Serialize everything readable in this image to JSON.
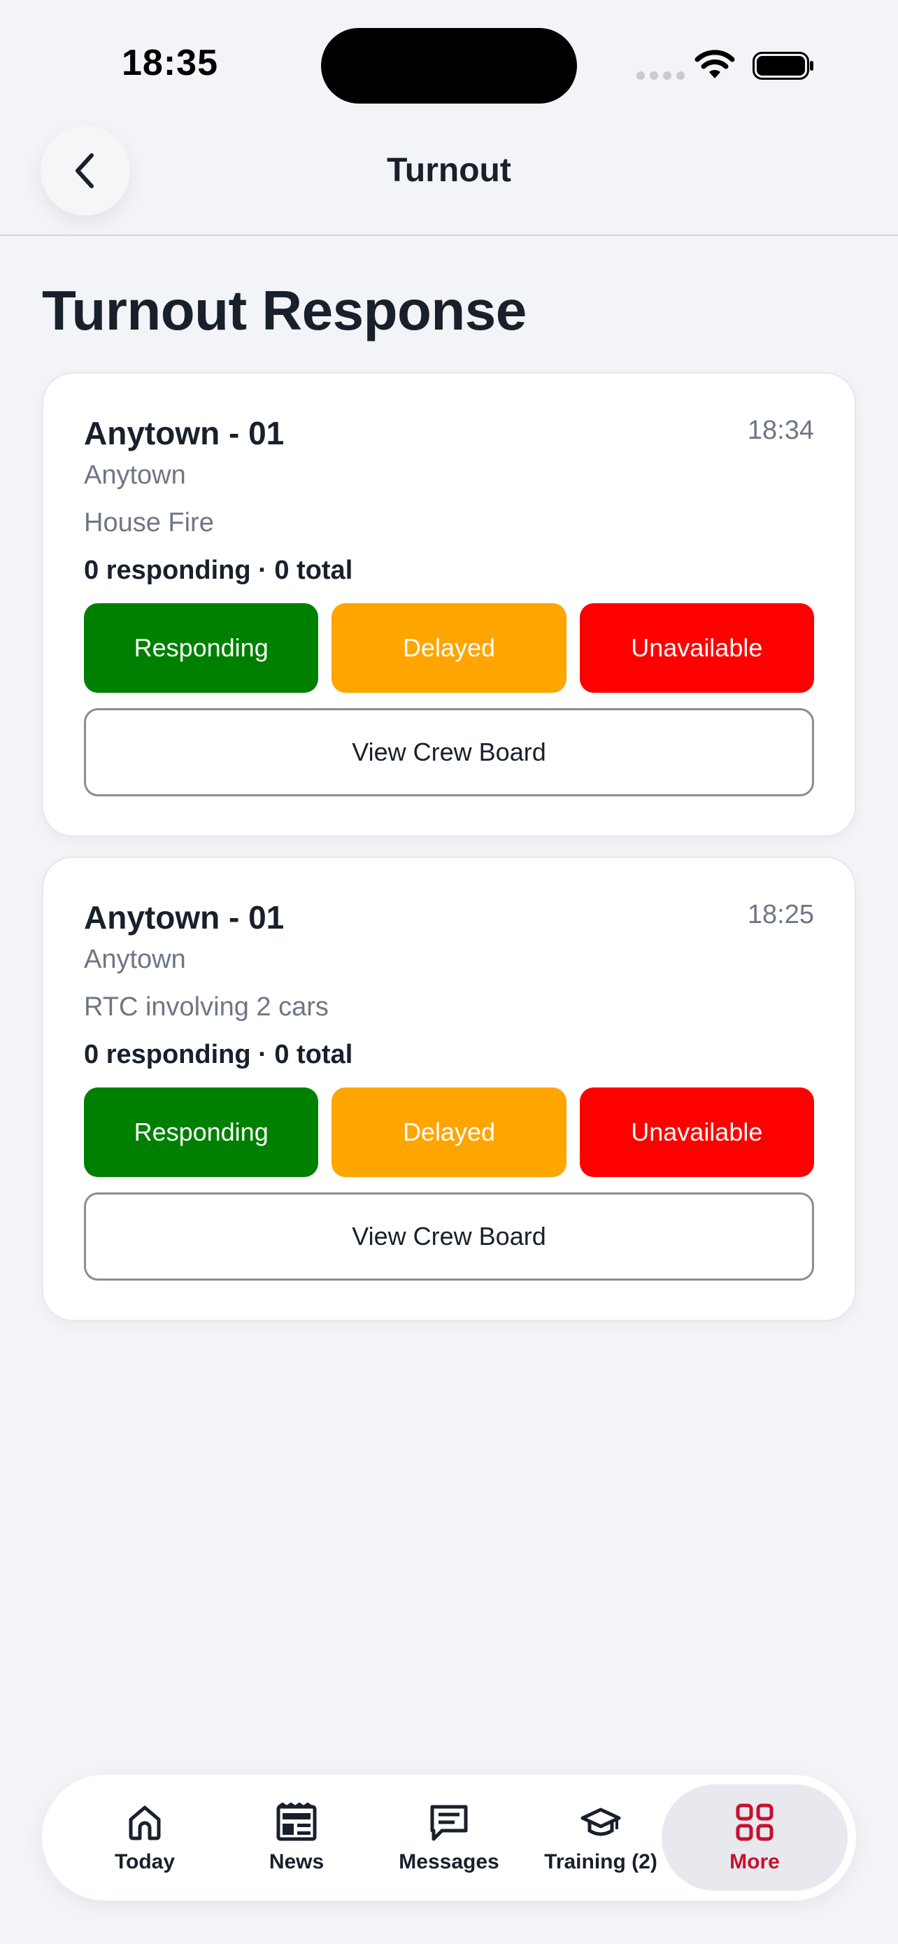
{
  "status_bar": {
    "time": "18:35"
  },
  "nav": {
    "title": "Turnout"
  },
  "page": {
    "title": "Turnout Response"
  },
  "cards": [
    {
      "title": "Anytown - 01",
      "time": "18:34",
      "location": "Anytown",
      "incident": "House Fire",
      "stats": "0 responding · 0 total",
      "buttons": {
        "responding": "Responding",
        "delayed": "Delayed",
        "unavailable": "Unavailable"
      },
      "crew_board": "View Crew Board"
    },
    {
      "title": "Anytown - 01",
      "time": "18:25",
      "location": "Anytown",
      "incident": "RTC involving 2 cars",
      "stats": "0 responding · 0 total",
      "buttons": {
        "responding": "Responding",
        "delayed": "Delayed",
        "unavailable": "Unavailable"
      },
      "crew_board": "View Crew Board"
    }
  ],
  "colors": {
    "responding": "#008000",
    "delayed": "#FFA500",
    "unavailable": "#FF0000",
    "active_tab": "#C8102E"
  },
  "tabs": [
    {
      "label": "Today",
      "icon": "home-icon",
      "active": false
    },
    {
      "label": "News",
      "icon": "newspaper-icon",
      "active": false
    },
    {
      "label": "Messages",
      "icon": "message-icon",
      "active": false
    },
    {
      "label": "Training (2)",
      "icon": "graduation-cap-icon",
      "active": false
    },
    {
      "label": "More",
      "icon": "grid-icon",
      "active": true
    }
  ]
}
